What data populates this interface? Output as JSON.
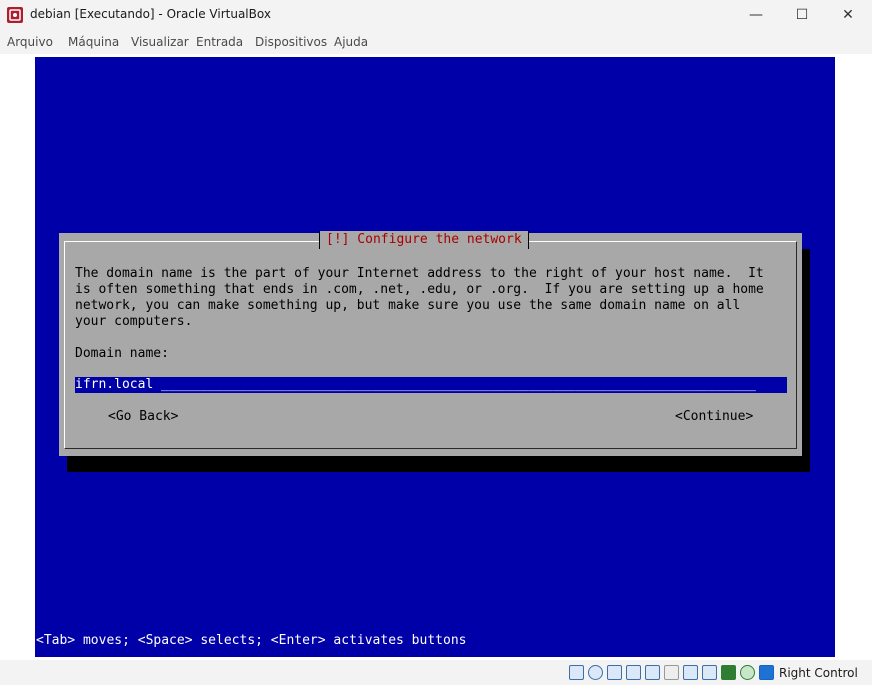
{
  "window": {
    "title": "debian [Executando] - Oracle VirtualBox",
    "controls": {
      "minimize": "—",
      "maximize": "☐",
      "close": "✕"
    }
  },
  "menu": [
    "Arquivo",
    "Máquina",
    "Visualizar",
    "Entrada",
    "Dispositivos",
    "Ajuda"
  ],
  "installer": {
    "dialog_title": "[!] Configure the network",
    "description": "The domain name is the part of your Internet address to the right of your host name.  It\nis often something that ends in .com, .net, .edu, or .org.  If you are setting up a home\nnetwork, you can make something up, but make sure you use the same domain name on all\nyour computers.",
    "field_label": "Domain name:",
    "field_value": "ifrn.local",
    "field_fill": "____________________________________________________________________________",
    "go_back": "<Go Back>",
    "continue": "<Continue>",
    "help_line": "<Tab> moves; <Space> selects; <Enter> activates buttons"
  },
  "statusbar": {
    "icons": [
      "hard-disk-icon",
      "optical-drive-icon",
      "audio-icon",
      "network-icon",
      "usb-icon",
      "shared-folders-icon",
      "display-icon",
      "recording-icon",
      "cpu-icon",
      "mouse-integration-icon",
      "host-key-icon"
    ],
    "host_key": "Right Control"
  },
  "colors": {
    "vm_background": "#0000a8",
    "dialog_background": "#a8a8a8",
    "dialog_title": "#a80000"
  }
}
